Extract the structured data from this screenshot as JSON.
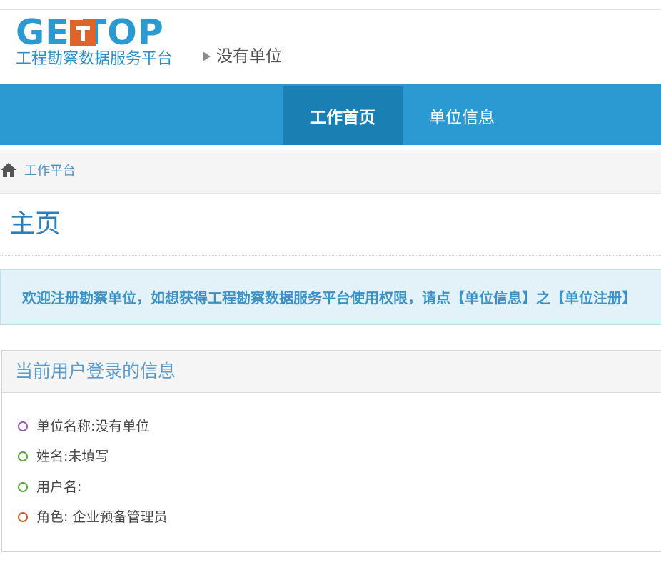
{
  "header": {
    "logo_word": "GE  TOP",
    "logo_subtitle": "工程勘察数据服务平台",
    "org_name": "没有单位"
  },
  "nav": {
    "items": [
      {
        "label": "工作首页",
        "active": true
      },
      {
        "label": "单位信息",
        "active": false
      }
    ]
  },
  "breadcrumb": {
    "home_icon": "home-icon",
    "label": "工作平台"
  },
  "page": {
    "title": "主页"
  },
  "alert": {
    "text": "欢迎注册勘察单位，如想获得工程勘察数据服务平台使用权限，请点【单位信息】之【单位注册】"
  },
  "panel": {
    "title": "当前用户登录的信息",
    "items": [
      {
        "text": "单位名称:没有单位",
        "color": "#9b59b6"
      },
      {
        "text": "姓名:未填写",
        "color": "#5aa83c"
      },
      {
        "text": "用户名:",
        "color": "#5aa83c"
      },
      {
        "text": "角色: 企业预备管理员",
        "color": "#d35a2c"
      }
    ]
  },
  "colors": {
    "nav_bg": "#2b9ad3",
    "nav_active": "#1a7fb2",
    "link": "#4a90c0",
    "alert_bg": "#e3f2f9"
  }
}
